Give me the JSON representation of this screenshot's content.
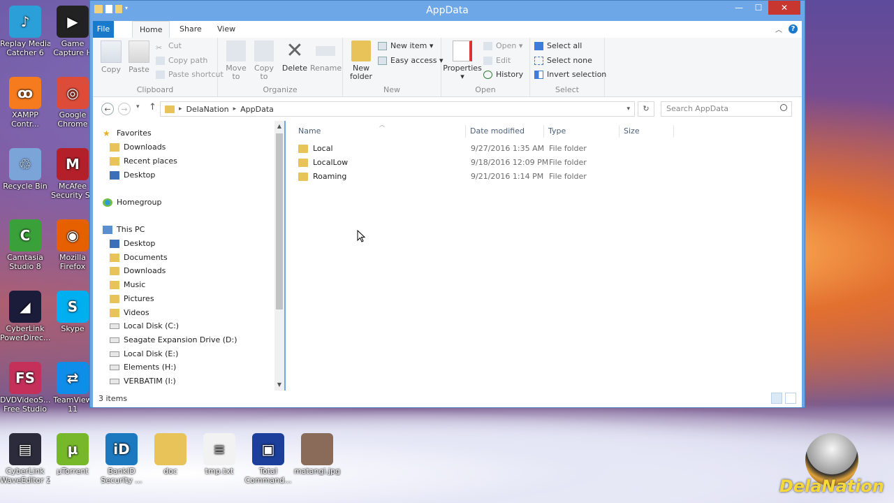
{
  "window": {
    "title": "AppData",
    "controls": {
      "minimize": "—",
      "maximize": "☐",
      "close": "✕"
    }
  },
  "ribbon": {
    "tabs": [
      "File",
      "Home",
      "Share",
      "View"
    ],
    "clipboard": {
      "copy": "Copy",
      "paste": "Paste",
      "cut": "Cut",
      "copy_path": "Copy path",
      "paste_shortcut": "Paste shortcut",
      "group": "Clipboard"
    },
    "organize": {
      "move_to_1": "Move",
      "move_to_2": "to",
      "copy_to_1": "Copy",
      "copy_to_2": "to",
      "delete": "Delete",
      "rename": "Rename",
      "group": "Organize"
    },
    "new": {
      "new_folder_1": "New",
      "new_folder_2": "folder",
      "new_item": "New item",
      "easy_access": "Easy access",
      "group": "New"
    },
    "open": {
      "properties": "Properties",
      "open": "Open",
      "edit": "Edit",
      "history": "History",
      "group": "Open"
    },
    "select": {
      "select_all": "Select all",
      "select_none": "Select none",
      "invert_selection": "Invert selection",
      "group": "Select"
    }
  },
  "address": {
    "crumbs": [
      "DelaNation",
      "AppData"
    ],
    "search_placeholder": "Search AppData"
  },
  "navpane": {
    "favorites": "Favorites",
    "fav_items": [
      "Downloads",
      "Recent places",
      "Desktop"
    ],
    "homegroup": "Homegroup",
    "thispc": "This PC",
    "pc_items": [
      "Desktop",
      "Documents",
      "Downloads",
      "Music",
      "Pictures",
      "Videos",
      "Local Disk (C:)",
      "Seagate Expansion Drive (D:)",
      "Local Disk (E:)",
      "Elements (H:)",
      "VERBATIM (I:)"
    ]
  },
  "files": {
    "columns": [
      "Name",
      "Date modified",
      "Type",
      "Size"
    ],
    "rows": [
      {
        "name": "Local",
        "date": "9/27/2016 1:35 AM",
        "type": "File folder"
      },
      {
        "name": "LocalLow",
        "date": "9/18/2016 12:09 PM",
        "type": "File folder"
      },
      {
        "name": "Roaming",
        "date": "9/21/2016 1:14 PM",
        "type": "File folder"
      }
    ]
  },
  "status": {
    "count": "3 items"
  },
  "desktop": {
    "icons": [
      {
        "l1": "Replay Media",
        "l2": "Catcher 6",
        "color": "#2a9fd8",
        "glyph": "♪"
      },
      {
        "l1": "Game",
        "l2": "Capture H",
        "color": "#222222",
        "glyph": "▶"
      },
      {
        "l1": "XAMPP",
        "l2": "Contr...",
        "color": "#f57b1e",
        "glyph": "ꝏ"
      },
      {
        "l1": "Google",
        "l2": "Chrome",
        "color": "#dd4b39",
        "glyph": "◎"
      },
      {
        "l1": "Recycle Bin",
        "l2": "",
        "color": "#7ba4d8",
        "glyph": "♲"
      },
      {
        "l1": "McAfee",
        "l2": "Security Sc",
        "color": "#b3202a",
        "glyph": "M"
      },
      {
        "l1": "Camtasia",
        "l2": "Studio 8",
        "color": "#3aa13a",
        "glyph": "C"
      },
      {
        "l1": "Mozilla",
        "l2": "Firefox",
        "color": "#e66000",
        "glyph": "◉"
      },
      {
        "l1": "CyberLink",
        "l2": "PowerDirec...",
        "color": "#1b1b3a",
        "glyph": "◢"
      },
      {
        "l1": "Skype",
        "l2": "",
        "color": "#00aff0",
        "glyph": "S"
      },
      {
        "l1": "DVDVideoS...",
        "l2": "Free Studio",
        "color": "#c4305a",
        "glyph": "FS"
      },
      {
        "l1": "TeamView",
        "l2": "11",
        "color": "#0e8ee9",
        "glyph": "⇄"
      },
      {
        "l1": "CyberLink",
        "l2": "WaveEditor 2",
        "color": "#2b2b3b",
        "glyph": "▤"
      },
      {
        "l1": "µTorrent",
        "l2": "",
        "color": "#77b82a",
        "glyph": "µ"
      },
      {
        "l1": "BankID",
        "l2": "Security ...",
        "color": "#1c79bf",
        "glyph": "iD"
      },
      {
        "l1": "doc",
        "l2": "",
        "color": "#e8c35a",
        "glyph": ""
      },
      {
        "l1": "tmp.txt",
        "l2": "",
        "color": "#f2f2f2",
        "glyph": "≡"
      },
      {
        "l1": "Total",
        "l2": "Command...",
        "color": "#1b3f9a",
        "glyph": "▣"
      },
      {
        "l1": "matangi.jpg",
        "l2": "",
        "color": "#8a6b5a",
        "glyph": ""
      }
    ]
  },
  "brand": {
    "name": "DelaNation"
  }
}
